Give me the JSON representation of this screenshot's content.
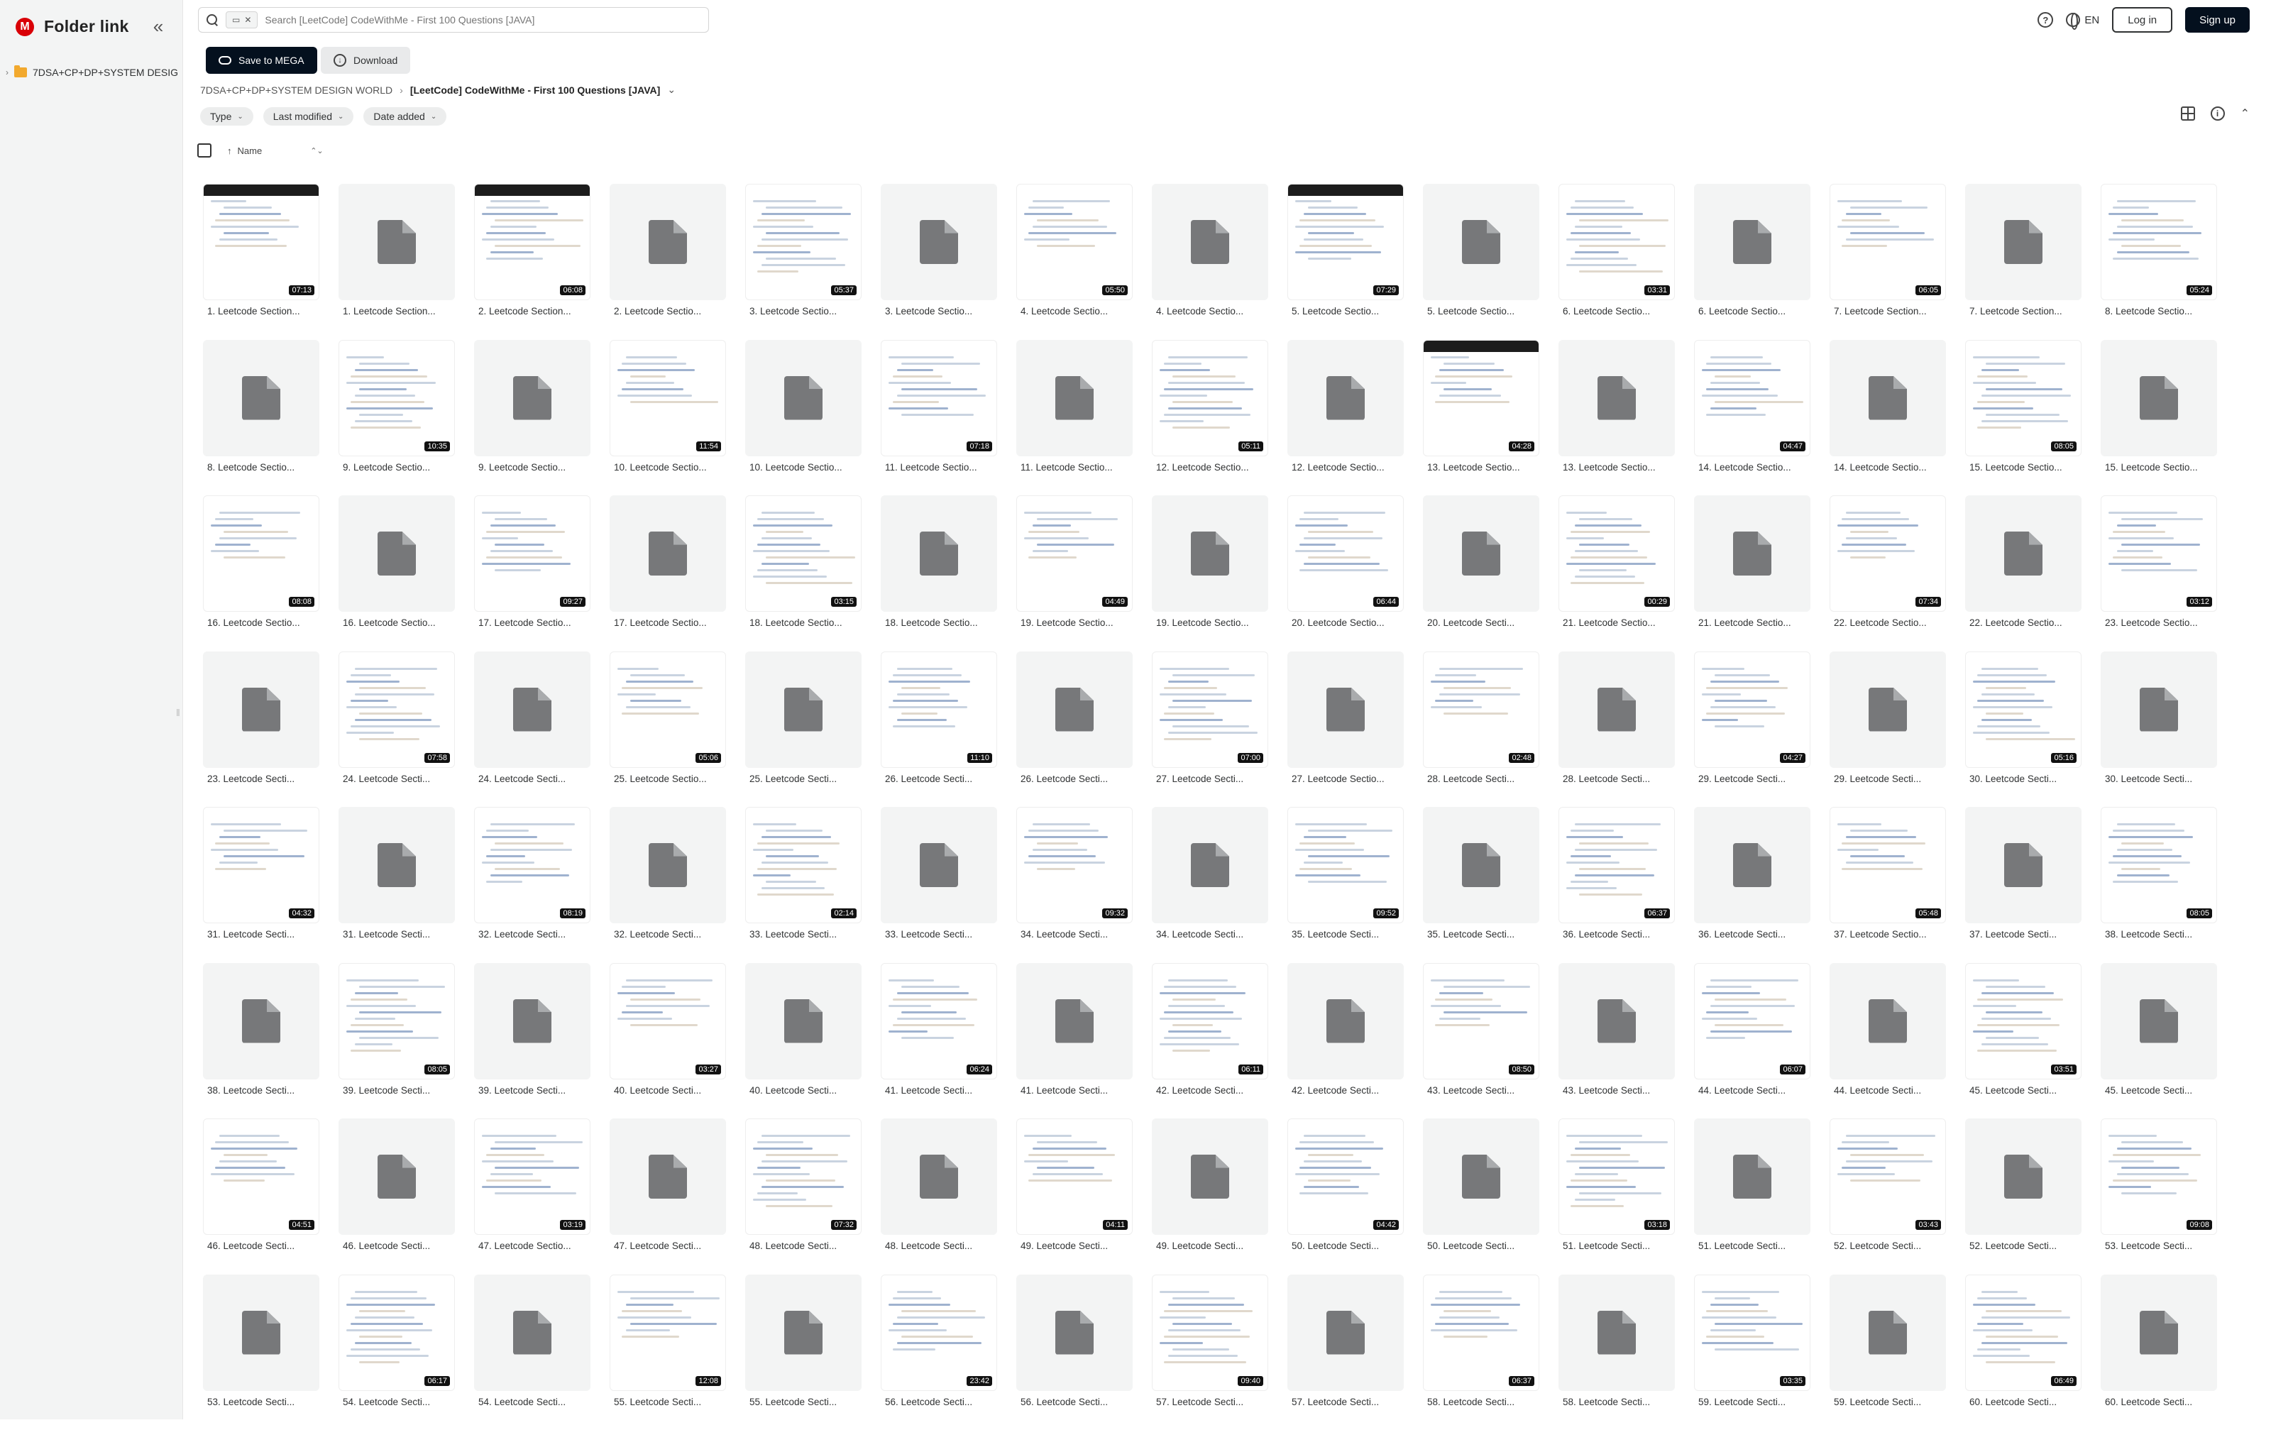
{
  "app": {
    "title": "Folder link",
    "logo_letter": "M"
  },
  "sidebar": {
    "collapse_glyph": "«",
    "tree": [
      {
        "label": "7DSA+CP+DP+SYSTEM DESIGN WORLD"
      }
    ]
  },
  "search": {
    "placeholder": "Search [LeetCode] CodeWithMe - First 100 Questions [JAVA]",
    "chip_close": "✕"
  },
  "header": {
    "help": "?",
    "language": "EN",
    "login_label": "Log in",
    "signup_label": "Sign up"
  },
  "actions": {
    "save_label": "Save to MEGA",
    "download_label": "Download"
  },
  "breadcrumb": {
    "parent": "7DSA+CP+DP+SYSTEM DESIGN WORLD",
    "separator": "›",
    "current": "[LeetCode] CodeWithMe - First 100 Questions [JAVA]",
    "current_chevron": "⌄"
  },
  "filters": [
    {
      "label": "Type"
    },
    {
      "label": "Last modified"
    },
    {
      "label": "Date added"
    }
  ],
  "sort": {
    "arrow": "↑",
    "label": "Name",
    "handle": "⌃⌄"
  },
  "icons": {
    "accent": "#d90007",
    "folder": "#f2a92e",
    "file_gray": "#77787a"
  },
  "tiles": [
    {
      "name": "1. Leetcode Section...",
      "kind": "video",
      "duration": "07:13",
      "dark": true
    },
    {
      "name": "1. Leetcode Section...",
      "kind": "file"
    },
    {
      "name": "2. Leetcode Section...",
      "kind": "video",
      "duration": "06:08",
      "dark": true
    },
    {
      "name": "2. Leetcode Sectio...",
      "kind": "file"
    },
    {
      "name": "3. Leetcode Sectio...",
      "kind": "video",
      "duration": "05:37"
    },
    {
      "name": "3. Leetcode Sectio...",
      "kind": "file"
    },
    {
      "name": "4. Leetcode Sectio...",
      "kind": "video",
      "duration": "05:50"
    },
    {
      "name": "4. Leetcode Sectio...",
      "kind": "file"
    },
    {
      "name": "5. Leetcode Sectio...",
      "kind": "video",
      "duration": "07:29",
      "dark": true
    },
    {
      "name": "5. Leetcode Sectio...",
      "kind": "file"
    },
    {
      "name": "6. Leetcode Sectio...",
      "kind": "video",
      "duration": "03:31"
    },
    {
      "name": "6. Leetcode Sectio...",
      "kind": "file"
    },
    {
      "name": "7. Leetcode Section...",
      "kind": "video",
      "duration": "06:05"
    },
    {
      "name": "7. Leetcode Section...",
      "kind": "file"
    },
    {
      "name": "8. Leetcode Sectio...",
      "kind": "video",
      "duration": "05:24"
    },
    {
      "name": "8. Leetcode Sectio...",
      "kind": "file"
    },
    {
      "name": "9. Leetcode Sectio...",
      "kind": "video",
      "duration": "10:35"
    },
    {
      "name": "9. Leetcode Sectio...",
      "kind": "file"
    },
    {
      "name": "10. Leetcode Sectio...",
      "kind": "video",
      "duration": "11:54"
    },
    {
      "name": "10. Leetcode Sectio...",
      "kind": "file"
    },
    {
      "name": "11. Leetcode Sectio...",
      "kind": "video",
      "duration": "07:18"
    },
    {
      "name": "11. Leetcode Sectio...",
      "kind": "file"
    },
    {
      "name": "12. Leetcode Sectio...",
      "kind": "video",
      "duration": "05:11"
    },
    {
      "name": "12. Leetcode Sectio...",
      "kind": "file"
    },
    {
      "name": "13. Leetcode Sectio...",
      "kind": "video",
      "duration": "04:28",
      "dark": true
    },
    {
      "name": "13. Leetcode Sectio...",
      "kind": "file"
    },
    {
      "name": "14. Leetcode Sectio...",
      "kind": "video",
      "duration": "04:47"
    },
    {
      "name": "14. Leetcode Sectio...",
      "kind": "file"
    },
    {
      "name": "15. Leetcode Sectio...",
      "kind": "video",
      "duration": "08:05"
    },
    {
      "name": "15. Leetcode Sectio...",
      "kind": "file"
    },
    {
      "name": "16. Leetcode Sectio...",
      "kind": "video",
      "duration": "08:08"
    },
    {
      "name": "16. Leetcode Sectio...",
      "kind": "file"
    },
    {
      "name": "17. Leetcode Sectio...",
      "kind": "video",
      "duration": "09:27"
    },
    {
      "name": "17. Leetcode Sectio...",
      "kind": "file"
    },
    {
      "name": "18. Leetcode Sectio...",
      "kind": "video",
      "duration": "03:15"
    },
    {
      "name": "18. Leetcode Sectio...",
      "kind": "file"
    },
    {
      "name": "19. Leetcode Sectio...",
      "kind": "video",
      "duration": "04:49"
    },
    {
      "name": "19. Leetcode Sectio...",
      "kind": "file"
    },
    {
      "name": "20. Leetcode Sectio...",
      "kind": "video",
      "duration": "06:44"
    },
    {
      "name": "20. Leetcode Secti...",
      "kind": "file"
    },
    {
      "name": "21. Leetcode Sectio...",
      "kind": "video",
      "duration": "00:29"
    },
    {
      "name": "21. Leetcode Sectio...",
      "kind": "file"
    },
    {
      "name": "22. Leetcode Sectio...",
      "kind": "video",
      "duration": "07:34"
    },
    {
      "name": "22. Leetcode Sectio...",
      "kind": "file"
    },
    {
      "name": "23. Leetcode Sectio...",
      "kind": "video",
      "duration": "03:12"
    },
    {
      "name": "23. Leetcode Secti...",
      "kind": "file"
    },
    {
      "name": "24. Leetcode Secti...",
      "kind": "video",
      "duration": "07:58"
    },
    {
      "name": "24. Leetcode Secti...",
      "kind": "file"
    },
    {
      "name": "25. Leetcode Sectio...",
      "kind": "video",
      "duration": "05:06"
    },
    {
      "name": "25. Leetcode Secti...",
      "kind": "file"
    },
    {
      "name": "26. Leetcode Secti...",
      "kind": "video",
      "duration": "11:10"
    },
    {
      "name": "26. Leetcode Secti...",
      "kind": "file"
    },
    {
      "name": "27. Leetcode Secti...",
      "kind": "video",
      "duration": "07:00"
    },
    {
      "name": "27. Leetcode Sectio...",
      "kind": "file"
    },
    {
      "name": "28. Leetcode Secti...",
      "kind": "video",
      "duration": "02:48"
    },
    {
      "name": "28. Leetcode Secti...",
      "kind": "file"
    },
    {
      "name": "29. Leetcode Secti...",
      "kind": "video",
      "duration": "04:27"
    },
    {
      "name": "29. Leetcode Secti...",
      "kind": "file"
    },
    {
      "name": "30. Leetcode Secti...",
      "kind": "video",
      "duration": "05:16"
    },
    {
      "name": "30. Leetcode Secti...",
      "kind": "file"
    },
    {
      "name": "31. Leetcode Secti...",
      "kind": "video",
      "duration": "04:32"
    },
    {
      "name": "31. Leetcode Secti...",
      "kind": "file"
    },
    {
      "name": "32. Leetcode Secti...",
      "kind": "video",
      "duration": "08:19"
    },
    {
      "name": "32. Leetcode Secti...",
      "kind": "file"
    },
    {
      "name": "33. Leetcode Secti...",
      "kind": "video",
      "duration": "02:14"
    },
    {
      "name": "33. Leetcode Secti...",
      "kind": "file"
    },
    {
      "name": "34. Leetcode Secti...",
      "kind": "video",
      "duration": "09:32"
    },
    {
      "name": "34. Leetcode Secti...",
      "kind": "file"
    },
    {
      "name": "35. Leetcode Secti...",
      "kind": "video",
      "duration": "09:52"
    },
    {
      "name": "35. Leetcode Secti...",
      "kind": "file"
    },
    {
      "name": "36. Leetcode Secti...",
      "kind": "video",
      "duration": "06:37"
    },
    {
      "name": "36. Leetcode Secti...",
      "kind": "file"
    },
    {
      "name": "37. Leetcode Sectio...",
      "kind": "video",
      "duration": "05:48"
    },
    {
      "name": "37. Leetcode Secti...",
      "kind": "file"
    },
    {
      "name": "38. Leetcode Secti...",
      "kind": "video",
      "duration": "08:05"
    },
    {
      "name": "38. Leetcode Secti...",
      "kind": "file"
    },
    {
      "name": "39. Leetcode Secti...",
      "kind": "video",
      "duration": "08:05"
    },
    {
      "name": "39. Leetcode Secti...",
      "kind": "file"
    },
    {
      "name": "40. Leetcode Secti...",
      "kind": "video",
      "duration": "03:27"
    },
    {
      "name": "40. Leetcode Secti...",
      "kind": "file"
    },
    {
      "name": "41. Leetcode Secti...",
      "kind": "video",
      "duration": "06:24"
    },
    {
      "name": "41. Leetcode Secti...",
      "kind": "file"
    },
    {
      "name": "42. Leetcode Secti...",
      "kind": "video",
      "duration": "06:11"
    },
    {
      "name": "42. Leetcode Secti...",
      "kind": "file"
    },
    {
      "name": "43. Leetcode Secti...",
      "kind": "video",
      "duration": "08:50"
    },
    {
      "name": "43. Leetcode Secti...",
      "kind": "file"
    },
    {
      "name": "44. Leetcode Secti...",
      "kind": "video",
      "duration": "06:07"
    },
    {
      "name": "44. Leetcode Secti...",
      "kind": "file"
    },
    {
      "name": "45. Leetcode Secti...",
      "kind": "video",
      "duration": "03:51"
    },
    {
      "name": "45. Leetcode Secti...",
      "kind": "file"
    },
    {
      "name": "46. Leetcode Secti...",
      "kind": "video",
      "duration": "04:51"
    },
    {
      "name": "46. Leetcode Secti...",
      "kind": "file"
    },
    {
      "name": "47. Leetcode Sectio...",
      "kind": "video",
      "duration": "03:19"
    },
    {
      "name": "47. Leetcode Secti...",
      "kind": "file"
    },
    {
      "name": "48. Leetcode Secti...",
      "kind": "video",
      "duration": "07:32"
    },
    {
      "name": "48. Leetcode Secti...",
      "kind": "file"
    },
    {
      "name": "49. Leetcode Secti...",
      "kind": "video",
      "duration": "04:11"
    },
    {
      "name": "49. Leetcode Secti...",
      "kind": "file"
    },
    {
      "name": "50. Leetcode Secti...",
      "kind": "video",
      "duration": "04:42"
    },
    {
      "name": "50. Leetcode Secti...",
      "kind": "file"
    },
    {
      "name": "51. Leetcode Secti...",
      "kind": "video",
      "duration": "03:18"
    },
    {
      "name": "51. Leetcode Secti...",
      "kind": "file"
    },
    {
      "name": "52. Leetcode Secti...",
      "kind": "video",
      "duration": "03:43"
    },
    {
      "name": "52. Leetcode Secti...",
      "kind": "file"
    },
    {
      "name": "53. Leetcode Secti...",
      "kind": "video",
      "duration": "09:08"
    },
    {
      "name": "53. Leetcode Secti...",
      "kind": "file"
    },
    {
      "name": "54. Leetcode Secti...",
      "kind": "video",
      "duration": "06:17"
    },
    {
      "name": "54. Leetcode Secti...",
      "kind": "file"
    },
    {
      "name": "55. Leetcode Secti...",
      "kind": "video",
      "duration": "12:08"
    },
    {
      "name": "55. Leetcode Secti...",
      "kind": "file"
    },
    {
      "name": "56. Leetcode Secti...",
      "kind": "video",
      "duration": "23:42"
    },
    {
      "name": "56. Leetcode Secti...",
      "kind": "file"
    },
    {
      "name": "57. Leetcode Secti...",
      "kind": "video",
      "duration": "09:40"
    },
    {
      "name": "57. Leetcode Secti...",
      "kind": "file"
    },
    {
      "name": "58. Leetcode Secti...",
      "kind": "video",
      "duration": "06:37"
    },
    {
      "name": "58. Leetcode Secti...",
      "kind": "file"
    },
    {
      "name": "59. Leetcode Secti...",
      "kind": "video",
      "duration": "03:35"
    },
    {
      "name": "59. Leetcode Secti...",
      "kind": "file"
    },
    {
      "name": "60. Leetcode Secti...",
      "kind": "video",
      "duration": "06:49"
    },
    {
      "name": "60. Leetcode Secti...",
      "kind": "file"
    }
  ]
}
